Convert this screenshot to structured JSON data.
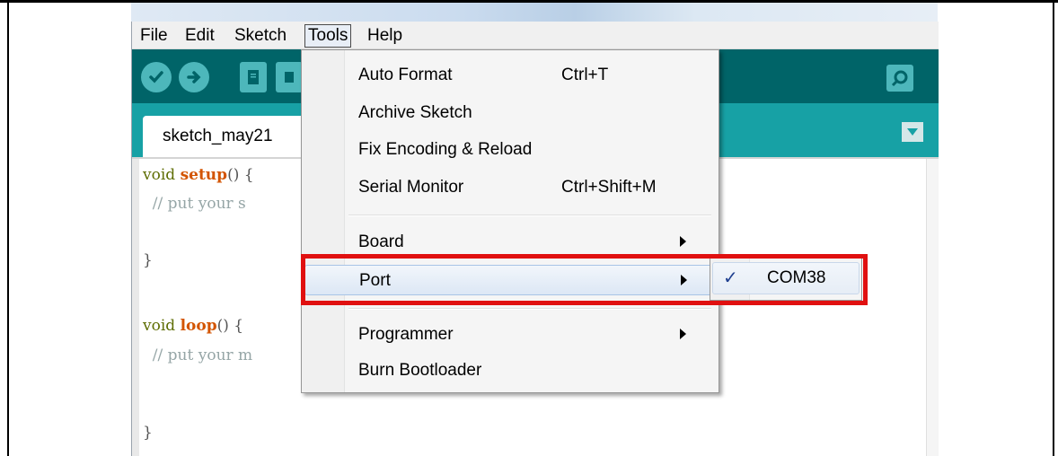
{
  "menubar": {
    "items": [
      "File",
      "Edit",
      "Sketch",
      "Tools",
      "Help"
    ],
    "active": "Tools"
  },
  "toolbar": {
    "buttons": [
      "verify-icon",
      "upload-icon",
      "new-icon",
      "open-icon",
      "serial-monitor-icon"
    ]
  },
  "tab": {
    "label": "sketch_may21"
  },
  "editor": {
    "lines": [
      {
        "kw": "void ",
        "fn": "setup",
        "rest": "() {"
      },
      {
        "comment": "  // put your s"
      },
      {
        "plain": "}"
      },
      {
        "kw": "void ",
        "fn": "loop",
        "rest": "() {"
      },
      {
        "comment": "  // put your m"
      },
      {
        "plain": "}"
      }
    ]
  },
  "tools_menu": {
    "items": [
      {
        "label": "Auto Format",
        "shortcut": "Ctrl+T"
      },
      {
        "label": "Archive Sketch",
        "shortcut": ""
      },
      {
        "label": "Fix Encoding & Reload",
        "shortcut": ""
      },
      {
        "label": "Serial Monitor",
        "shortcut": "Ctrl+Shift+M"
      },
      {
        "label": "Board",
        "submenu": true
      },
      {
        "label": "Port",
        "submenu": true,
        "hover": true
      },
      {
        "label": "Programmer",
        "submenu": true
      },
      {
        "label": "Burn Bootloader",
        "shortcut": ""
      }
    ]
  },
  "port_submenu": {
    "check": "✓",
    "label": "COM38",
    "selected": true
  },
  "colors": {
    "toolbar": "#006468",
    "tabstrip": "#17a1a5",
    "button": "#4db7bb",
    "highlight": "#e01010"
  }
}
